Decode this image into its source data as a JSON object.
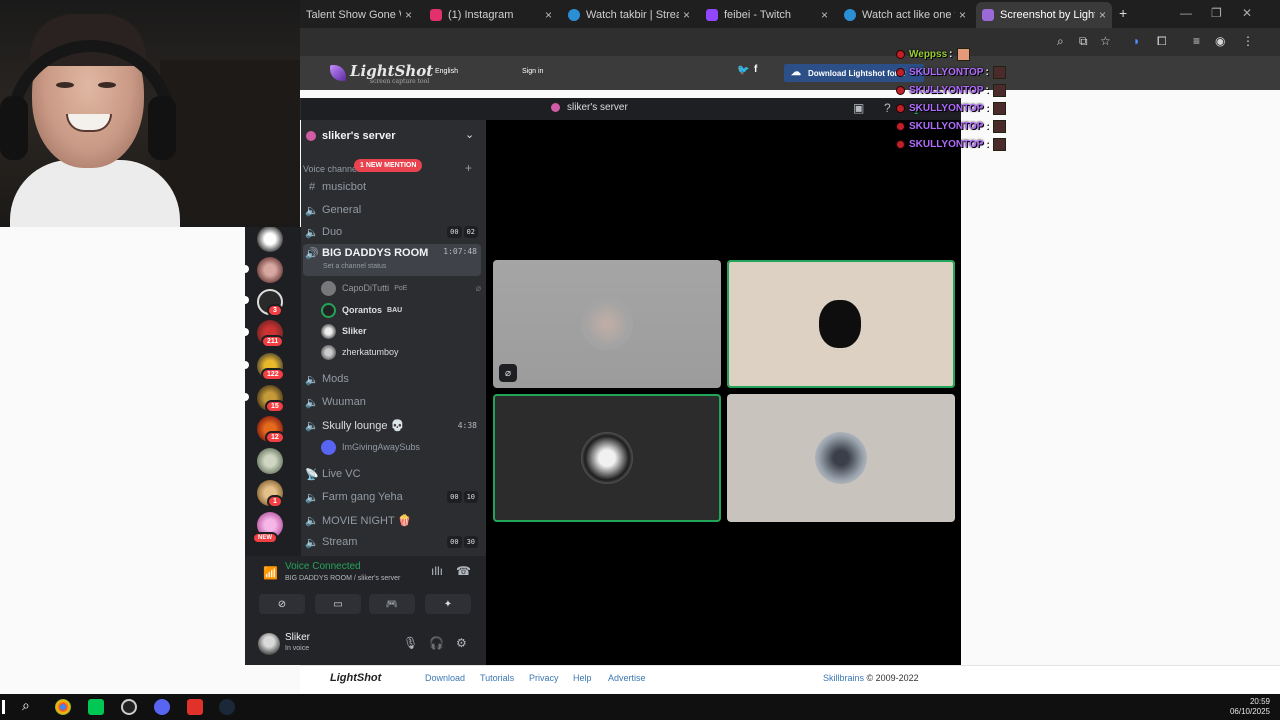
{
  "browser": {
    "tabs": [
      {
        "title": "Talent Show Gone Wrong",
        "color": "#444444"
      },
      {
        "title": "(1) Instagram",
        "color": "#e1306c"
      },
      {
        "title": "Watch takbir | Streamable",
        "color": "#2b8fd6"
      },
      {
        "title": "feibei - Twitch",
        "color": "#9146ff"
      },
      {
        "title": "Watch act like one first | S",
        "color": "#2b8fd6"
      },
      {
        "title": "Screenshot by Lightshot",
        "color": "#9b6ad6"
      }
    ],
    "new_tab": "+",
    "close_glyph": "×"
  },
  "lightshot": {
    "logo": "LightShot",
    "logo_sub": "screen capture tool",
    "language": "English",
    "signin": "Sign in",
    "download_btn": "Download Lightshot for fr",
    "footer_logo": "LightShot",
    "footer_links": [
      "Download",
      "Tutorials",
      "Privacy",
      "Help",
      "Advertise"
    ],
    "footer_company": "Skillbrains",
    "footer_copy": " © 2009-2022"
  },
  "discord": {
    "window_title": "sliker's server",
    "server_name": "sliker's server",
    "voice_header": "Voice channels",
    "mention_pill": "1 NEW MENTION",
    "guild_badges": [
      "3",
      "211",
      "122",
      "15",
      "12",
      "1",
      "NEW"
    ],
    "channels": {
      "musicbot": {
        "name": "musicbot"
      },
      "general": {
        "name": "General"
      },
      "duo": {
        "name": "Duo",
        "a": "00",
        "b": "02"
      },
      "bigdaddys": {
        "name": "BIG DADDYS ROOM",
        "time": "1:07:48",
        "status": "Set a channel status"
      },
      "mods": {
        "name": "Mods"
      },
      "wuuman": {
        "name": "Wuuman"
      },
      "skully": {
        "name": "Skully lounge 💀",
        "time": "4:38"
      },
      "livevc": {
        "name": "Live VC"
      },
      "farm": {
        "name": "Farm gang Yeha",
        "a": "00",
        "b": "10"
      },
      "movie": {
        "name": "MOVIE NIGHT 🍿"
      },
      "stream": {
        "name": "Stream",
        "a": "00",
        "b": "30"
      }
    },
    "users": [
      {
        "name": "CapoDiTutti",
        "activity": "PoE"
      },
      {
        "name": "Qorantos",
        "activity": "BAU"
      },
      {
        "name": "Sliker",
        "activity": ""
      },
      {
        "name": "zherkatumboy",
        "activity": ""
      }
    ],
    "skully_user": "ImGivingAwaySubs",
    "voice_panel": {
      "status": "Voice Connected",
      "sub": "BIG DADDYS ROOM / sliker's server"
    },
    "user_panel": {
      "name": "Sliker",
      "status": "In voice"
    }
  },
  "chat": [
    {
      "name": "Weppss",
      "color": "#9acd32"
    },
    {
      "name": "SKULLYONTOP",
      "color": "#b26bff"
    },
    {
      "name": "SKULLYONTOP",
      "color": "#b26bff"
    },
    {
      "name": "SKULLYONTOP",
      "color": "#b26bff"
    },
    {
      "name": "SKULLYONTOP",
      "color": "#b26bff"
    },
    {
      "name": "SKULLYONTOP",
      "color": "#b26bff"
    }
  ],
  "taskbar": {
    "time": "20:59",
    "date": "06/10/2025"
  }
}
